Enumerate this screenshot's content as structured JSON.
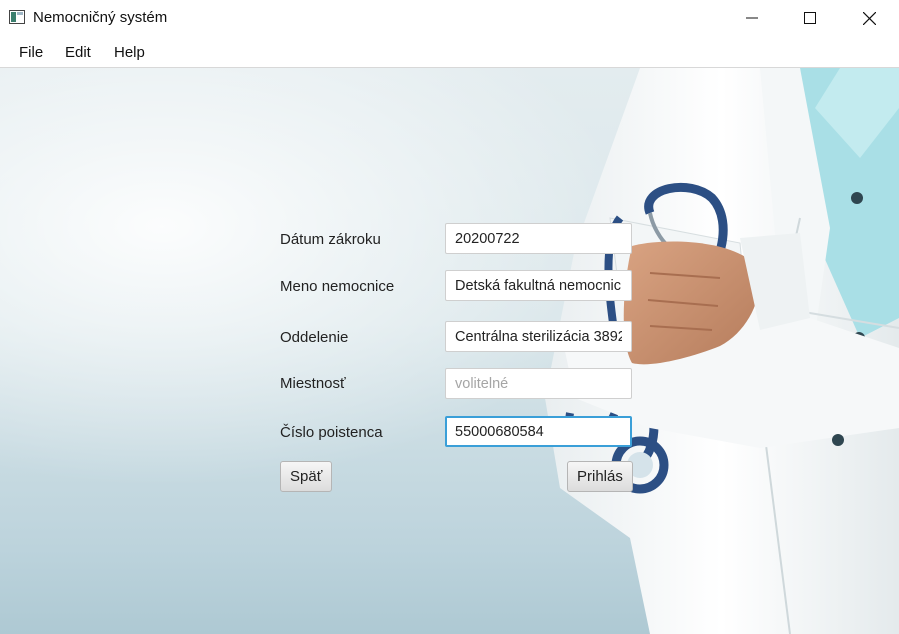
{
  "window": {
    "title": "Nemocničný systém",
    "icons": {
      "app": "app-window-icon",
      "minimize": "minimize-icon",
      "maximize": "maximize-icon",
      "close": "close-icon"
    }
  },
  "menu": {
    "items": [
      {
        "label": "File"
      },
      {
        "label": "Edit"
      },
      {
        "label": "Help"
      }
    ]
  },
  "form": {
    "date": {
      "label": "Dátum zákroku",
      "value": "20200722"
    },
    "hospital": {
      "label": "Meno nemocnice",
      "value": "Detská fakultná nemocnic"
    },
    "department": {
      "label": "Oddelenie",
      "value": "Centrálna sterilizácia 3892"
    },
    "room": {
      "label": "Miestnosť",
      "value": "",
      "placeholder": "volitelné"
    },
    "insured": {
      "label": "Číslo poistenca",
      "value": "55000680584"
    }
  },
  "buttons": {
    "back": "Späť",
    "submit": "Prihlás"
  },
  "colors": {
    "focus_border": "#3a9fd8",
    "stethoscope": "#2c4f84",
    "shirt": "#a9dfe6"
  }
}
